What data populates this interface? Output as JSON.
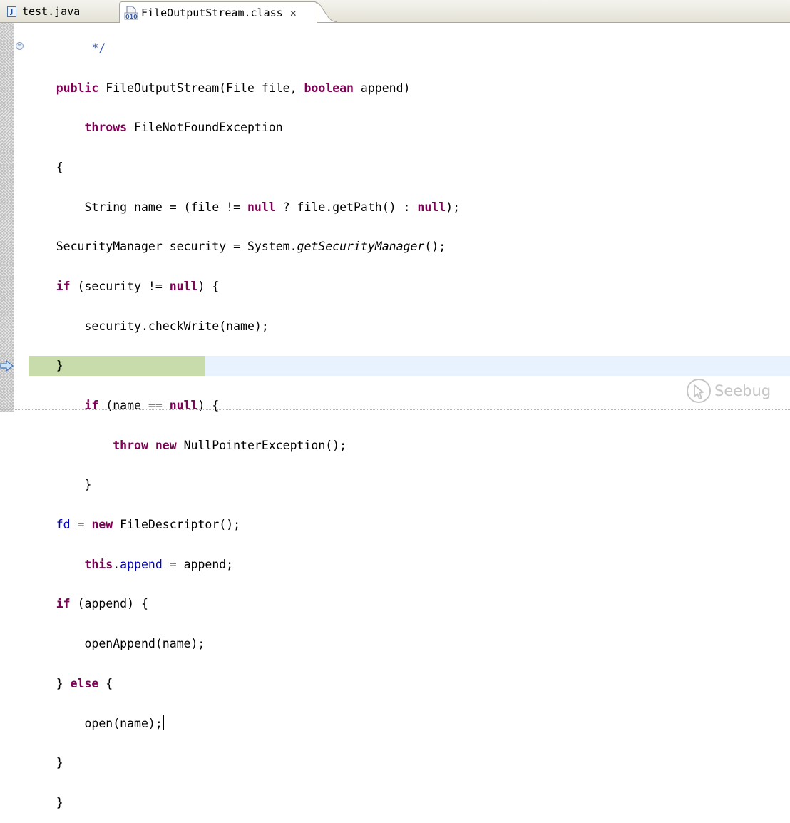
{
  "tabs": [
    {
      "label": "test.java",
      "icon": "java-file-icon",
      "active": false
    },
    {
      "label": "FileOutputStream.class",
      "icon": "class-file-icon",
      "active": true,
      "close_glyph": "✕"
    }
  ],
  "editor": {
    "comment_fragment": "*/",
    "lines": {
      "l01_kw": "public",
      "l01_rest_a": " FileOutputStream(File file, ",
      "l01_kw2": "boolean",
      "l01_rest_b": " append)",
      "l02_kw": "throws",
      "l02_rest": " FileNotFoundException",
      "l03": "{",
      "l04_a": "String name = (file != ",
      "l04_kw": "null",
      "l04_b": " ? file.getPath() : ",
      "l04_kw2": "null",
      "l04_c": ");",
      "l05_a": "SecurityManager security = System.",
      "l05_it": "getSecurityManager",
      "l05_b": "();",
      "l06_kw": "if",
      "l06_a": " (security != ",
      "l06_kw2": "null",
      "l06_b": ") {",
      "l07": "security.checkWrite(name);",
      "l08": "}",
      "l09_kw": "if",
      "l09_a": " (name == ",
      "l09_kw2": "null",
      "l09_b": ") {",
      "l10_kw": "throw",
      "l10_kw2": "new",
      "l10_rest": " NullPointerException();",
      "l11": "}",
      "l12_fld": "fd",
      "l12_a": " = ",
      "l12_kw": "new",
      "l12_b": " FileDescriptor();",
      "l13_kw": "this",
      "l13_a": ".",
      "l13_fld": "append",
      "l13_b": " = append;",
      "l14_kw": "if",
      "l14_a": " (append) {",
      "l15": "openAppend(name);",
      "l16_a": "} ",
      "l16_kw": "else",
      "l16_b": " {",
      "l17": "open(name);",
      "l18": "}",
      "l19": "}"
    }
  },
  "watermark": {
    "text": "Seebug"
  },
  "colors": {
    "keyword": "#7f0055",
    "field": "#0000c0",
    "current_line": "#e8f2fe",
    "debug_line": "#c7dcaa"
  }
}
